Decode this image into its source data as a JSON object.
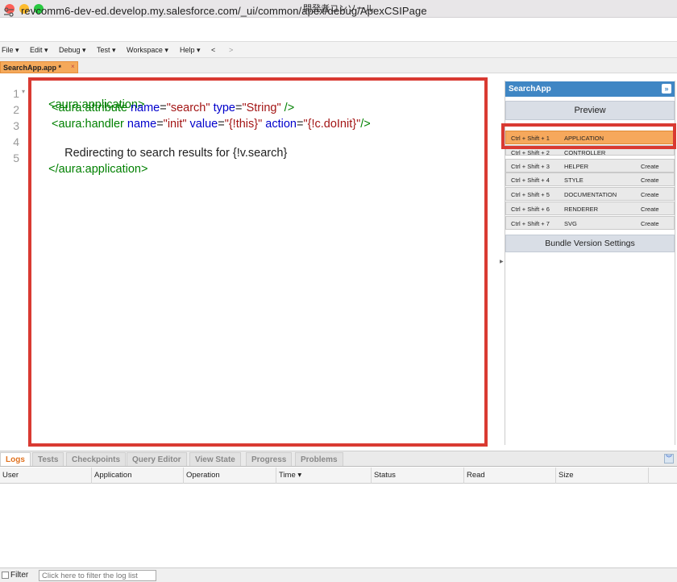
{
  "window": {
    "title": "開発者コンソール"
  },
  "browser": {
    "url": "revcomm6-dev-ed.develop.my.salesforce.com/_ui/common/apex/debug/ApexCSIPage"
  },
  "menu": {
    "items": [
      "File ▾",
      "Edit ▾",
      "Debug ▾",
      "Test ▾",
      "Workspace ▾",
      "Help ▾",
      "<",
      ">"
    ]
  },
  "file_tab": {
    "label": "SearchApp.app *",
    "close": "×"
  },
  "editor": {
    "line_numbers": [
      "1",
      "2",
      "3",
      "4",
      "5"
    ],
    "lines": {
      "l1_tag": "<aura:application>",
      "l2_tag_open": "<aura:attribute",
      "l2_attr1": "name",
      "l2_eq1": "=",
      "l2_val1": "\"search\"",
      "l2_attr2": "type",
      "l2_eq2": "=",
      "l2_val2": "\"String\"",
      "l2_close": "/>",
      "l3_tag_open": "<aura:handler",
      "l3_attr1": "name",
      "l3_eq1": "=",
      "l3_val1": "\"init\"",
      "l3_attr2": "value",
      "l3_eq2": "=",
      "l3_val2": "\"{!this}\"",
      "l3_attr3": "action",
      "l3_eq3": "=",
      "l3_val3": "\"{!c.doInit}\"",
      "l3_close": "/>",
      "l4_text": "Redirecting to search results for {!v.search}",
      "l5_tag": "</aura:application>"
    }
  },
  "bundle_panel": {
    "title": "SearchApp",
    "expand_icon": "»",
    "preview_label": "Preview",
    "rows": [
      {
        "shortcut": "Ctrl + Shift + 1",
        "name": "APPLICATION",
        "action": ""
      },
      {
        "shortcut": "Ctrl + Shift + 2",
        "name": "CONTROLLER",
        "action": ""
      },
      {
        "shortcut": "Ctrl + Shift + 3",
        "name": "HELPER",
        "action": "Create"
      },
      {
        "shortcut": "Ctrl + Shift + 4",
        "name": "STYLE",
        "action": "Create"
      },
      {
        "shortcut": "Ctrl + Shift + 5",
        "name": "DOCUMENTATION",
        "action": "Create"
      },
      {
        "shortcut": "Ctrl + Shift + 6",
        "name": "RENDERER",
        "action": "Create"
      },
      {
        "shortcut": "Ctrl + Shift + 7",
        "name": "SVG",
        "action": "Create"
      }
    ],
    "bundle_version_label": "Bundle Version Settings"
  },
  "bottom_tabs": [
    "Logs",
    "Tests",
    "Checkpoints",
    "Query Editor",
    "View State",
    "Progress",
    "Problems"
  ],
  "log_table": {
    "columns": [
      "User",
      "Application",
      "Operation",
      "Time ▾",
      "Status",
      "Read",
      "Size"
    ]
  },
  "filter": {
    "label": "Filter",
    "placeholder": "Click here to filter the log list"
  },
  "colors": {
    "accent_orange": "#f6a85c",
    "panel_blue": "#3f86c4",
    "highlight_red": "#d93a32"
  }
}
